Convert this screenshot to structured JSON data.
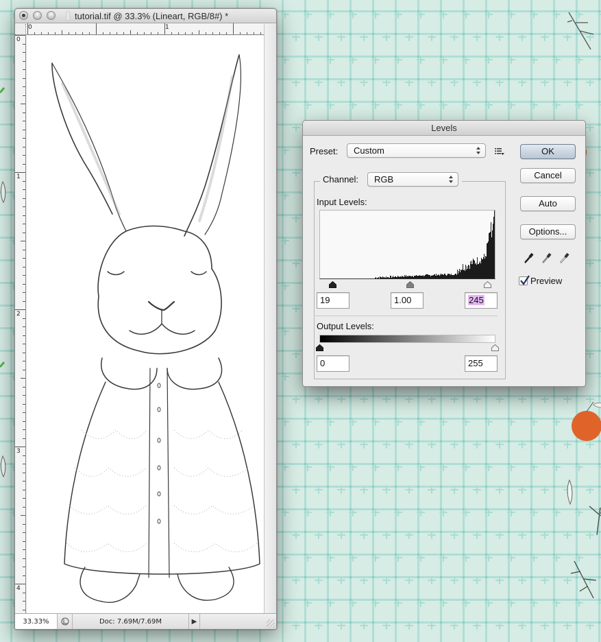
{
  "document_window": {
    "title": "tutorial.tif @ 33.3% (Lineart, RGB/8#) *",
    "ruler_h_labels": [
      "0",
      "1"
    ],
    "ruler_v_labels": [
      "0",
      "1",
      "2",
      "3",
      "4"
    ],
    "status": {
      "zoom": "33.33%",
      "doc_info": "Doc: 7.69M/7.69M"
    },
    "canvas_content": "pencil sketch of a rabbit wearing a buttoned dress"
  },
  "levels_dialog": {
    "title": "Levels",
    "preset_label": "Preset:",
    "preset_value": "Custom",
    "channel_label": "Channel:",
    "channel_value": "RGB",
    "input_levels_label": "Input Levels:",
    "input_black": "19",
    "input_gamma": "1.00",
    "input_white": "245",
    "output_levels_label": "Output Levels:",
    "output_black": "0",
    "output_white": "255",
    "buttons": {
      "ok": "OK",
      "cancel": "Cancel",
      "auto": "Auto",
      "options": "Options..."
    },
    "preview_label": "Preview",
    "preview_checked": true,
    "eyedroppers": [
      "black-point",
      "gray-point",
      "white-point"
    ],
    "colors": {
      "selection_highlight": "#e5b7f2",
      "default_button": "#b9c6d4"
    }
  },
  "background": {
    "description": "mint watercolor pattern with apples, pears, flowers, leaves",
    "base_color": "#d6ece4"
  }
}
